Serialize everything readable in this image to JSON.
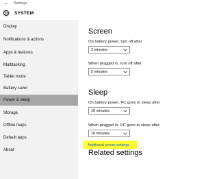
{
  "window": {
    "title": "Settings",
    "back_glyph": "←"
  },
  "header": {
    "title": "SYSTEM",
    "icon": "gear-icon"
  },
  "sidebar": {
    "items": [
      {
        "label": "Display",
        "selected": false
      },
      {
        "label": "Notifications & actions",
        "selected": false
      },
      {
        "label": "Apps & features",
        "selected": false
      },
      {
        "label": "Multitasking",
        "selected": false
      },
      {
        "label": "Tablet mode",
        "selected": false
      },
      {
        "label": "Battery saver",
        "selected": false
      },
      {
        "label": "Power & sleep",
        "selected": true
      },
      {
        "label": "Storage",
        "selected": false
      },
      {
        "label": "Offline maps",
        "selected": false
      },
      {
        "label": "Default apps",
        "selected": false
      },
      {
        "label": "About",
        "selected": false
      }
    ]
  },
  "screen": {
    "title": "Screen",
    "battery_label": "On battery power, turn off after",
    "battery_value": "2 minutes",
    "plugged_label": "When plugged in, turn off after",
    "plugged_value": "5 minutes"
  },
  "sleep": {
    "title": "Sleep",
    "battery_label": "On battery power, PC goes to sleep after",
    "battery_value": "10 minutes",
    "plugged_label": "When plugged in, PC goes to sleep after",
    "plugged_value": "10 minutes"
  },
  "related": {
    "title": "Related settings",
    "link": "Additional power settings"
  },
  "colors": {
    "selected_item_bg": "#a6a6a6",
    "sidebar_bg": "#f2f2f2",
    "link": "#1a5fa8",
    "highlight": "#ffff33"
  }
}
